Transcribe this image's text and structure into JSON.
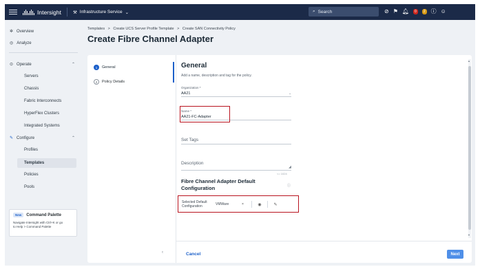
{
  "topbar": {
    "brand": "Intersight",
    "service": "Infrastructure Service",
    "search_label": "Search",
    "badge_red": "0",
    "badge_yellow": "2"
  },
  "sidebar": {
    "overview": "Overview",
    "analyze": "Analyze",
    "operate": "Operate",
    "operate_items": [
      "Servers",
      "Chassis",
      "Fabric Interconnects",
      "HyperFlex Clusters",
      "Integrated Systems"
    ],
    "configure": "Configure",
    "configure_items": [
      "Profiles",
      "Templates",
      "Policies",
      "Pools"
    ],
    "command_palette": {
      "badge": "New",
      "title": "Command Palette",
      "body_1": "Navigate Intersight with Ctrl+K or go",
      "body_2": "to Help > Command Palette"
    }
  },
  "breadcrumb": {
    "items": [
      "Templates",
      "Create UCS Server Profile Template",
      "Create SAN Connectivity Policy"
    ],
    "sep": ">"
  },
  "page_title": "Create Fibre Channel Adapter",
  "steps": [
    {
      "num": "1",
      "label": "General"
    },
    {
      "num": "2",
      "label": "Policy Details"
    }
  ],
  "form": {
    "heading": "General",
    "hint": "Add a name, description and tag for the policy.",
    "org_label": "Organization *",
    "org_value": "AA21",
    "name_label": "Name *",
    "name_value": "AA21-FC-Adapter",
    "tags_placeholder": "Set Tags",
    "desc_placeholder": "Description",
    "desc_counter": "<= 1024",
    "default_heading": "Fibre Channel Adapter Default Configuration",
    "selected_label": "Selected Default Configuration",
    "selected_value": "VMWare"
  },
  "footer": {
    "cancel": "Cancel",
    "next": "Next"
  },
  "colors": {
    "topbar": "#1b2a48",
    "accent": "#1b5fc9",
    "highlight": "#b8121e",
    "primary_button": "#4f8fe8"
  }
}
